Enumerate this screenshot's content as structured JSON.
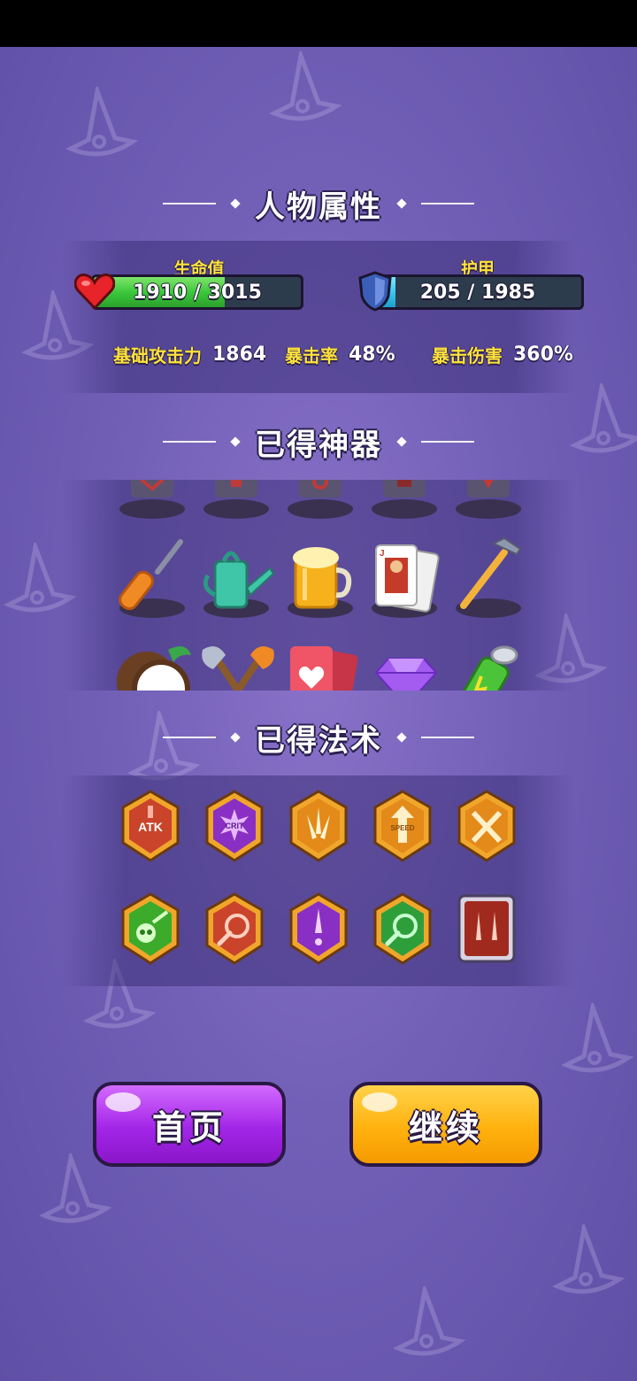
{
  "status_bar": {},
  "sections": {
    "attributes_title": "人物属性",
    "artifacts_title": "已得神器",
    "spells_title": "已得法术"
  },
  "health": {
    "label": "生命值",
    "value_text": "1910 / 3015",
    "current": 1910,
    "max": 3015,
    "color": "#3cc83c"
  },
  "armor": {
    "label": "护甲",
    "value_text": "205 / 1985",
    "current": 205,
    "max": 1985,
    "color": "#39c8ef"
  },
  "stats": {
    "attack_label": "基础攻击力",
    "attack_value": "1864",
    "crit_rate_label": "暴击率",
    "crit_rate_value": "48%",
    "crit_damage_label": "暴击伤害",
    "crit_damage_value": "360%"
  },
  "artifacts": [
    {
      "name": "screwdriver-icon"
    },
    {
      "name": "watering-can-icon"
    },
    {
      "name": "beer-mug-icon"
    },
    {
      "name": "playing-card-jack-icon"
    },
    {
      "name": "hammer-icon"
    },
    {
      "name": "coconut-icon"
    },
    {
      "name": "crossed-axes-icon"
    },
    {
      "name": "heart-card-icon"
    },
    {
      "name": "diamond-icon"
    },
    {
      "name": "battery-icon"
    }
  ],
  "spells": {
    "row1": [
      {
        "name": "atk-up-spell-icon",
        "label": "ATK",
        "color": "#c9442b"
      },
      {
        "name": "crit-up-spell-icon",
        "label": "CRIT",
        "color": "#8a2fc3"
      },
      {
        "name": "multishot-spell-icon",
        "label": "",
        "color": "#e38a1a"
      },
      {
        "name": "speed-up-spell-icon",
        "label": "SPEED",
        "color": "#e38a1a"
      },
      {
        "name": "crossed-swords-spell-icon",
        "label": "",
        "color": "#e38a1a"
      }
    ],
    "row2": [
      {
        "name": "poison-skull-spell-icon",
        "label": "",
        "color": "#3caa2a"
      },
      {
        "name": "fire-orb-spell-icon",
        "label": "",
        "color": "#c9442b"
      },
      {
        "name": "piercing-arrow-spell-icon",
        "label": "",
        "color": "#8a2fc3"
      },
      {
        "name": "green-orb-spell-icon",
        "label": "",
        "color": "#2e9e3b"
      },
      {
        "name": "double-arrow-spell-icon",
        "label": "",
        "color": "#a02a1e"
      }
    ]
  },
  "buttons": {
    "home_label": "首页",
    "continue_label": "继续"
  }
}
